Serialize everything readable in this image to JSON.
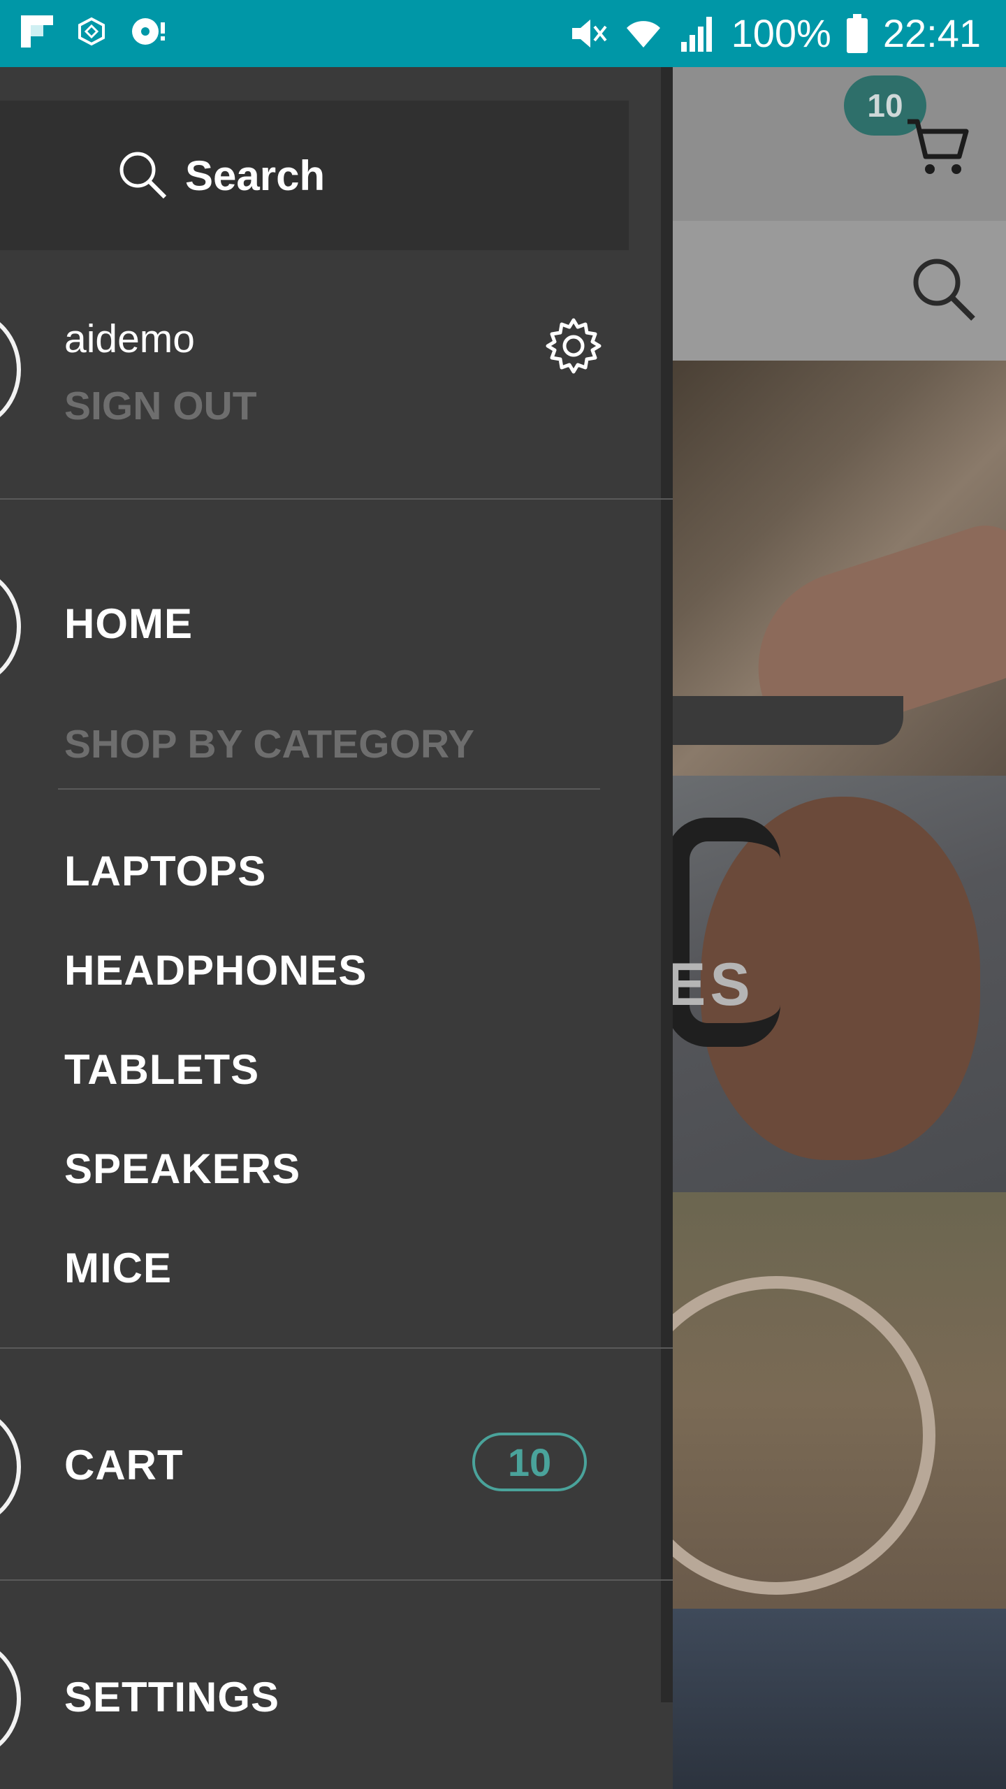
{
  "status_bar": {
    "battery": "100%",
    "time": "22:41",
    "icons": [
      "flipboard-icon",
      "app-icon",
      "record-icon",
      "mute-icon",
      "wifi-icon",
      "signal-icon",
      "battery-icon"
    ]
  },
  "drawer": {
    "search": {
      "label": "Search",
      "icon": "search-icon"
    },
    "user": {
      "name": "aidemo",
      "sign_out": "SIGN OUT",
      "settings_icon": "gear-icon"
    },
    "home": "HOME",
    "category_header": "SHOP BY CATEGORY",
    "categories": [
      {
        "label": "LAPTOPS"
      },
      {
        "label": "HEADPHONES"
      },
      {
        "label": "TABLETS"
      },
      {
        "label": "SPEAKERS"
      },
      {
        "label": "MICE"
      }
    ],
    "cart": {
      "label": "CART",
      "count": "10"
    },
    "settings": "SETTINGS"
  },
  "background_app": {
    "cart_badge": "10",
    "tile_text": "ES"
  },
  "colors": {
    "status_bar": "#0097a7",
    "drawer_bg": "#3a3a3a",
    "search_bg": "#303030",
    "muted_text": "#6e6e6e",
    "accent": "#4aa39b"
  }
}
